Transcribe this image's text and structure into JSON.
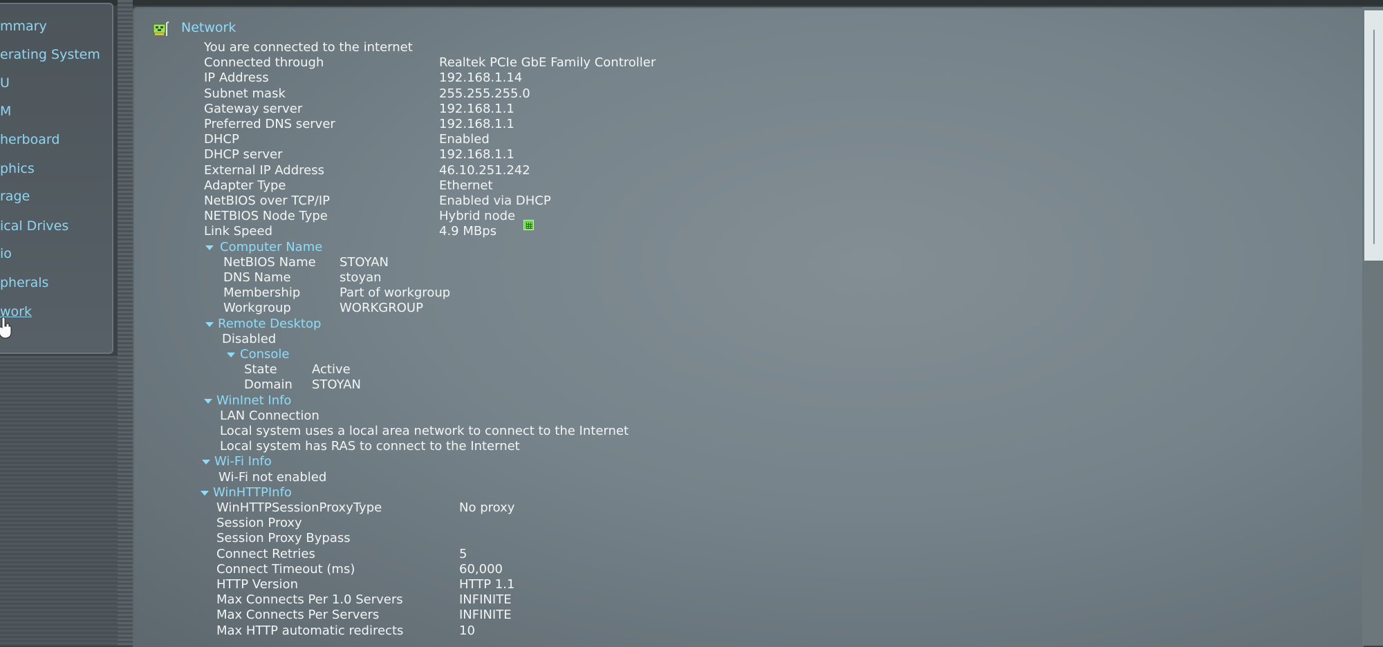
{
  "sidebar": {
    "items": [
      {
        "label": "mmary"
      },
      {
        "label": "erating System"
      },
      {
        "label": "U"
      },
      {
        "label": "M"
      },
      {
        "label": "herboard"
      },
      {
        "label": "phics"
      },
      {
        "label": "rage"
      },
      {
        "label": "ical Drives"
      },
      {
        "label": "io"
      },
      {
        "label": "pherals"
      },
      {
        "label": "work",
        "active": true
      }
    ]
  },
  "network": {
    "title": "Network",
    "icon": "network-card-icon",
    "status": "You are connected to the internet",
    "rows": [
      {
        "label": "Connected through",
        "value": "Realtek PCIe GbE Family Controller"
      },
      {
        "label": "IP Address",
        "value": "192.168.1.14"
      },
      {
        "label": "Subnet mask",
        "value": "255.255.255.0"
      },
      {
        "label": "Gateway server",
        "value": "192.168.1.1"
      },
      {
        "label": "Preferred DNS server",
        "value": "192.168.1.1"
      },
      {
        "label": "DHCP",
        "value": "Enabled"
      },
      {
        "label": "DHCP server",
        "value": "192.168.1.1"
      },
      {
        "label": "External IP Address",
        "value": "46.10.251.242"
      },
      {
        "label": "Adapter Type",
        "value": "Ethernet"
      },
      {
        "label": "NetBIOS over TCP/IP",
        "value": "Enabled via DHCP"
      },
      {
        "label": "NETBIOS Node Type",
        "value": "Hybrid node"
      },
      {
        "label": "Link Speed",
        "value": "4.9 MBps"
      }
    ],
    "link_speed_icon": "speed-graph-icon",
    "computer_name": {
      "header": "Computer Name",
      "rows": [
        {
          "label": "NetBIOS Name",
          "value": "STOYAN"
        },
        {
          "label": "DNS Name",
          "value": "stoyan"
        },
        {
          "label": "Membership",
          "value": "Part of workgroup"
        },
        {
          "label": "Workgroup",
          "value": "WORKGROUP"
        }
      ]
    },
    "remote_desktop": {
      "header": "Remote Desktop",
      "status": "Disabled",
      "console": {
        "header": "Console",
        "rows": [
          {
            "label": "State",
            "value": "Active"
          },
          {
            "label": "Domain",
            "value": "STOYAN"
          }
        ]
      }
    },
    "wininet": {
      "header": "WinInet Info",
      "lines": [
        "LAN Connection",
        "Local system uses a local area network to connect to the Internet",
        "Local system has RAS to connect to the Internet"
      ]
    },
    "wifi": {
      "header": "Wi-Fi Info",
      "lines": [
        "Wi-Fi not enabled"
      ]
    },
    "winhttp": {
      "header": "WinHTTPInfo",
      "rows": [
        {
          "label": "WinHTTPSessionProxyType",
          "value": "No proxy"
        },
        {
          "label": "Session Proxy",
          "value": ""
        },
        {
          "label": "Session Proxy Bypass",
          "value": ""
        },
        {
          "label": "Connect Retries",
          "value": "5"
        },
        {
          "label": "Connect Timeout (ms)",
          "value": "60,000"
        },
        {
          "label": "HTTP Version",
          "value": "HTTP 1.1"
        },
        {
          "label": "Max Connects Per 1.0 Servers",
          "value": "INFINITE"
        },
        {
          "label": "Max Connects Per Servers",
          "value": "INFINITE"
        },
        {
          "label": "Max HTTP automatic redirects",
          "value": "10"
        }
      ]
    }
  },
  "colors": {
    "heading": "#8fdcf8",
    "text": "#f2f5f6",
    "panel": "#76838a",
    "sidebar": "#4d555a",
    "link_speed_icon": "#6fd64a"
  }
}
